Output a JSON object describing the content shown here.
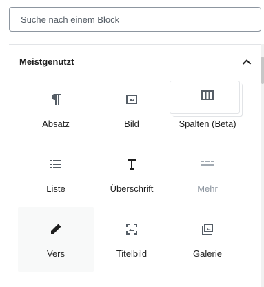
{
  "search": {
    "placeholder": "Suche nach einem Block"
  },
  "panel": {
    "title": "Meistgenutzt"
  },
  "blocks": [
    {
      "label": "Absatz",
      "icon": "paragraph-icon"
    },
    {
      "label": "Bild",
      "icon": "image-icon"
    },
    {
      "label": "Spalten (Beta)",
      "icon": "columns-icon"
    },
    {
      "label": "Liste",
      "icon": "list-icon"
    },
    {
      "label": "Überschrift",
      "icon": "heading-icon"
    },
    {
      "label": "Mehr",
      "icon": "more-icon"
    },
    {
      "label": "Vers",
      "icon": "pencil-icon"
    },
    {
      "label": "Titelbild",
      "icon": "cover-image-icon"
    },
    {
      "label": "Galerie",
      "icon": "gallery-icon"
    }
  ]
}
